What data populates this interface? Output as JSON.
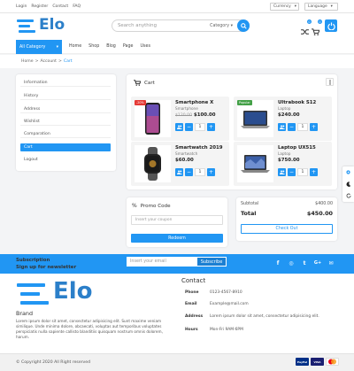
{
  "topbar": {
    "links": [
      "Login",
      "Register",
      "Contact",
      "FAQ"
    ],
    "currency_label": "Currency",
    "language_label": "Language"
  },
  "header": {
    "logo_text": "Elo",
    "search_placeholder": "Search anything",
    "search_category": "Category",
    "wishlist_count": "0",
    "cart_count": "0"
  },
  "nav": {
    "all_category": "All Category",
    "links": [
      "Home",
      "Shop",
      "Blog",
      "Page",
      "Uses"
    ]
  },
  "breadcrumb": [
    "Home",
    ">",
    "Account",
    ">",
    "Cart"
  ],
  "sidebar": {
    "items": [
      "Information",
      "History",
      "Address",
      "Wishlist",
      "Comparation",
      "Cart",
      "Logout"
    ],
    "active_index": 5
  },
  "cart": {
    "title": "Cart",
    "products": [
      {
        "name": "Smartphone X",
        "category": "Smartphone",
        "old_price": "$120.00",
        "price": "$100.00",
        "qty": "1",
        "tag": "-20%",
        "tag_color": "#e53935"
      },
      {
        "name": "Ultrabook S12",
        "category": "Laptop",
        "old_price": "",
        "price": "$240.00",
        "qty": "1",
        "tag": "Popular",
        "tag_color": "#43a047"
      },
      {
        "name": "Smartwatch 2019",
        "category": "Smartwatch",
        "old_price": "",
        "price": "$60.00",
        "qty": "1",
        "tag": "",
        "tag_color": ""
      },
      {
        "name": "Laptop UX515",
        "category": "Laptop",
        "old_price": "",
        "price": "$750.00",
        "qty": "1",
        "tag": "",
        "tag_color": ""
      }
    ]
  },
  "promo": {
    "title": "Promo Code",
    "placeholder": "Insert your coupon",
    "button": "Redeem"
  },
  "summary": {
    "subtotal_label": "Subtotal",
    "subtotal_value": "$400.00",
    "total_label": "Total",
    "total_value": "$450.00",
    "checkout": "Check Out"
  },
  "subscribe": {
    "title": "Subscription",
    "subtitle": "Sign up for newsletter",
    "placeholder": "Insert your email",
    "button": "Subscribe",
    "social": [
      "f",
      "◎",
      "t",
      "G+",
      "✉"
    ]
  },
  "footer": {
    "brand": "Brand",
    "about": "Lorem ipsum dolor sit amet, consectetur adipisicing elit. Sunt maxime veniam similique. Unde minima dolore, obcaecati, voluptas aut temporibus voluptates perspiciatis nulla sapiente callisto blanditiis quisquam nostrum omnis dolorem, harum.",
    "contact_title": "Contact",
    "contact": [
      {
        "k": "Phone",
        "v": "0123-4567-8910"
      },
      {
        "k": "Email",
        "v": "Example@mail.com"
      },
      {
        "k": "Address",
        "v": "Lorem ipsum dolor sit amet, consectetur adipisicing elit."
      },
      {
        "k": "Hours",
        "v": "Mon-Fri 9AM-6PM"
      }
    ],
    "copyright": "© Copyright 2020 All Right reserved",
    "payments": [
      "PayPal",
      "VISA",
      ""
    ]
  },
  "colors": {
    "accent": "#2196f3"
  }
}
